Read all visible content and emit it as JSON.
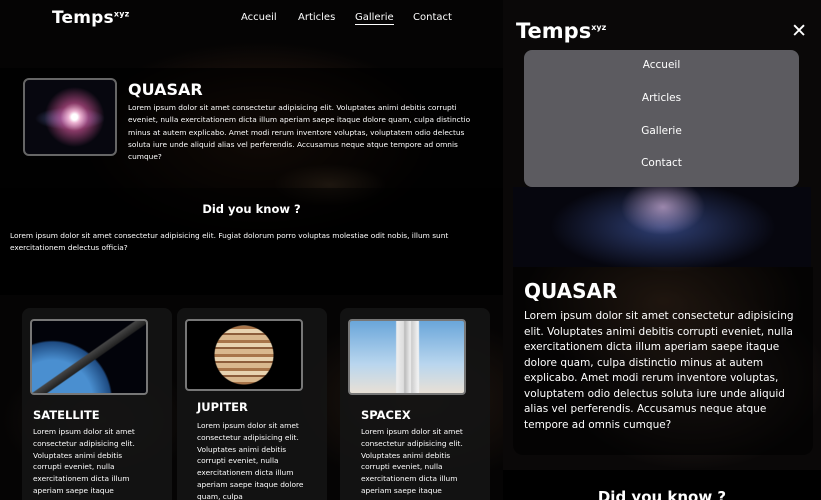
{
  "brand": {
    "name": "Temps",
    "sup": "xyz"
  },
  "nav": {
    "items": [
      {
        "label": "Accueil"
      },
      {
        "label": "Articles"
      },
      {
        "label": "Gallerie"
      },
      {
        "label": "Contact"
      }
    ],
    "active": "Gallerie"
  },
  "quasar": {
    "title": "QUASAR",
    "text": "Lorem ipsum dolor sit amet consectetur adipisicing elit. Voluptates animi debitis corrupti eveniet, nulla exercitationem dicta illum aperiam saepe itaque dolore quam, culpa distinctio minus at autem explicabo. Amet modi rerum inventore voluptas, voluptatem odio delectus soluta iure unde aliquid alias vel perferendis. Accusamus neque atque tempore ad omnis cumque?"
  },
  "didYouKnow": {
    "title": "Did you know ?",
    "text": "Lorem ipsum dolor sit amet consectetur adipisicing elit. Fugiat dolorum porro voluptas molestiae odit nobis, illum sunt exercitationem delectus officia?"
  },
  "cards": [
    {
      "title": "SATELLITE",
      "icon": "satellite-image",
      "text": "Lorem ipsum dolor sit amet consectetur adipisicing elit. Voluptates animi debitis corrupti eveniet, nulla exercitationem dicta illum aperiam saepe itaque"
    },
    {
      "title": "JUPITER",
      "icon": "jupiter-image",
      "text": "Lorem ipsum dolor sit amet consectetur adipisicing elit. Voluptates animi debitis corrupti eveniet, nulla exercitationem dicta illum aperiam saepe itaque dolore quam, culpa"
    },
    {
      "title": "SPACEX",
      "icon": "spacex-image",
      "text": "Lorem ipsum dolor sit amet consectetur adipisicing elit. Voluptates animi debitis corrupti eveniet, nulla exercitationem dicta illum aperiam saepe itaque"
    }
  ],
  "mobile": {
    "close": "✕",
    "menuItems": [
      "Accueil",
      "Articles",
      "Gallerie",
      "Contact"
    ]
  }
}
